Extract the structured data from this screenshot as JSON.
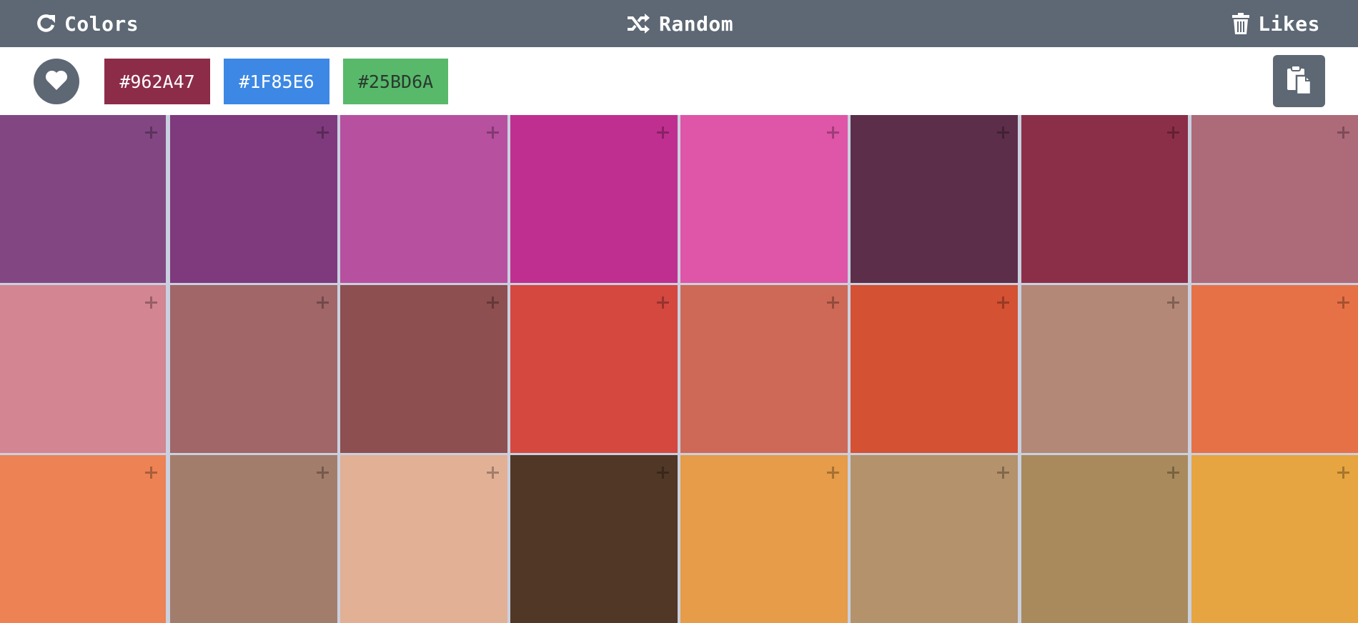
{
  "topbar": {
    "colors_label": "Colors",
    "random_label": "Random",
    "likes_label": "Likes",
    "colors_icon": "refresh-icon",
    "random_icon": "shuffle-icon",
    "likes_icon": "trash-icon"
  },
  "selection": {
    "like_icon": "heart-icon",
    "chips": [
      {
        "label": "#962A47",
        "bg": "#8d2c49",
        "fg": "#ffffff"
      },
      {
        "label": "#1F85E6",
        "bg": "#3d88e4",
        "fg": "#ffffff"
      },
      {
        "label": "#25BD6A",
        "bg": "#58b96b",
        "fg": "#2a3a2e"
      }
    ],
    "clipboard_icon": "clipboard-icon"
  },
  "grid": {
    "rows": [
      [
        "#824782",
        "#7e3a7c",
        "#b7509f",
        "#bf2f8f",
        "#df55a8",
        "#5c2e49",
        "#8b2f48",
        "#ad6a79"
      ],
      [
        "#d38591",
        "#a06668",
        "#8d4f50",
        "#d44840",
        "#cd6956",
        "#d45133",
        "#b38877",
        "#e77146"
      ],
      [
        "#ed8254",
        "#a37d6b",
        "#e2b095",
        "#503726",
        "#e69c48",
        "#b4926b",
        "#a98a5c",
        "#e6a540"
      ]
    ]
  }
}
